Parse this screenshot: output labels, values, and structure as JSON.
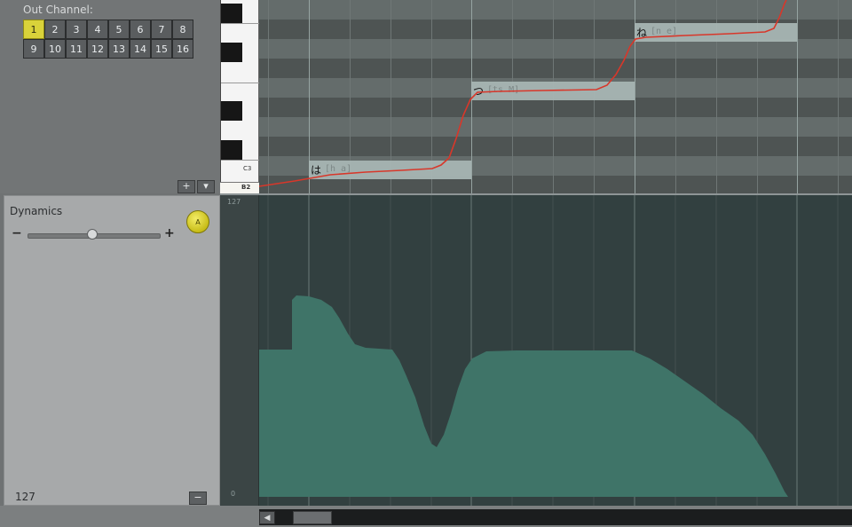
{
  "out_channel": {
    "label": "Out Channel:",
    "channels": [
      "1",
      "2",
      "3",
      "4",
      "5",
      "6",
      "7",
      "8",
      "9",
      "10",
      "11",
      "12",
      "13",
      "14",
      "15",
      "16"
    ],
    "selected": "1"
  },
  "panel_buttons": {
    "add": "+",
    "menu": "▾"
  },
  "keys": {
    "c3_label": "C3",
    "b2_label": "B2"
  },
  "notes": [
    {
      "lyric": "は",
      "phonemes": "[h a]"
    },
    {
      "lyric": "つ",
      "phonemes": "[ts M]"
    },
    {
      "lyric": "ね",
      "phonemes": "[n e]"
    }
  ],
  "dynamics": {
    "title": "Dynamics",
    "auto_label": "A",
    "minus": "−",
    "plus": "+",
    "value": "127",
    "collapse": "−",
    "axis_max": "127",
    "axis_min": "0"
  },
  "colors": {
    "pitch_curve": "#d8372a",
    "dynamics_fill": "#3f7468",
    "channel_selected": "#d9d23a"
  },
  "scrollbar": {
    "left_arrow": "◀"
  }
}
